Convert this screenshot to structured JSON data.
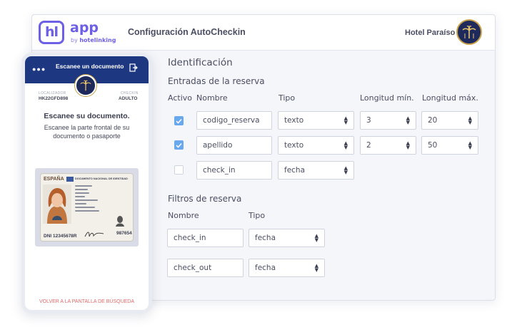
{
  "header": {
    "logo_mark": "hl",
    "logo_app": "app",
    "logo_by_prefix": "by",
    "logo_by_brand": "hotelinking",
    "title": "Configuración AutoCheckin",
    "hotel_name": "Hotel Paraíso",
    "hotel_logo_icon": "palm-tree-icon"
  },
  "identification": {
    "title": "Identificación",
    "reservation_entries_title": "Entradas de la reserva",
    "columns": {
      "active": "Activo",
      "name": "Nombre",
      "type": "Tipo",
      "min_length": "Longitud mín.",
      "max_length": "Longitud máx."
    },
    "rows": [
      {
        "active": true,
        "name": "codigo_reserva",
        "type": "texto",
        "min": "3",
        "max": "20"
      },
      {
        "active": true,
        "name": "apellido",
        "type": "texto",
        "min": "2",
        "max": "50"
      },
      {
        "active": false,
        "name": "check_in",
        "type": "fecha"
      }
    ]
  },
  "filters": {
    "title": "Filtros de reserva",
    "columns": {
      "name": "Nombre",
      "type": "Tipo"
    },
    "rows": [
      {
        "name": "check_in",
        "type": "fecha"
      },
      {
        "name": "check_out",
        "type": "fecha"
      }
    ]
  },
  "phone": {
    "header_title": "Escanee un documento",
    "menu_icon": "dots-icon",
    "exit_icon": "exit-icon",
    "locator_label": "LOCALIZADOR",
    "locator_value": "HK22GFD898",
    "guest_label": "CHECKIN",
    "guest_value": "ADULTO",
    "heading": "Escanee su documento.",
    "instructions": "Escanee la parte frontal de su documento o pasaporte",
    "id_country": "ESPAÑA",
    "id_doc_title": "DOCUMENTO NACIONAL DE IDENTIDAD",
    "id_number": "DNI 12345678R",
    "id_support": "987654",
    "back_link": "VOLVER A LA PANTALLA DE BÚSQUEDA"
  },
  "colors": {
    "brand_purple": "#6d5fe6",
    "phone_header": "#1e3781",
    "checkbox_checked": "#6aa8ee",
    "back_link": "#e06a6a"
  }
}
